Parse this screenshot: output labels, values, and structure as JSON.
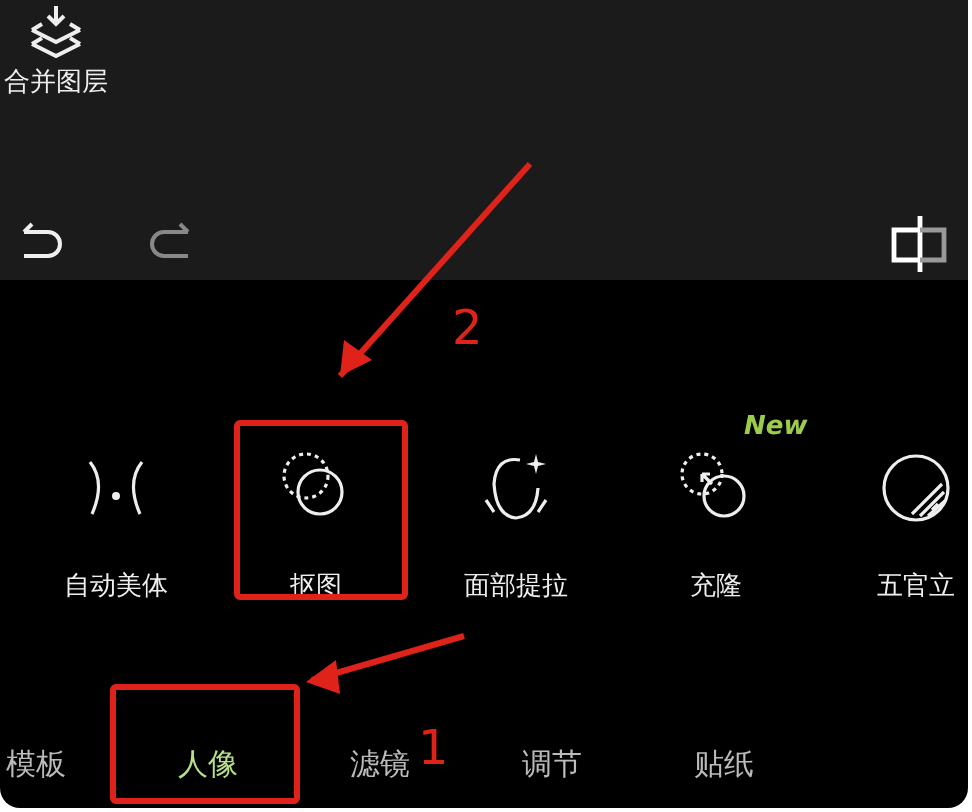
{
  "top_bar": {
    "merge_layers": "合并图层"
  },
  "tools": [
    {
      "label": "自动美体"
    },
    {
      "label": "抠图"
    },
    {
      "label": "面部提拉"
    },
    {
      "label": "充隆",
      "badge": "New"
    },
    {
      "label": "五官立"
    }
  ],
  "tabs": [
    {
      "label": "模板",
      "selected": false
    },
    {
      "label": "人像",
      "selected": true
    },
    {
      "label": "滤镜",
      "selected": false
    },
    {
      "label": "调节",
      "selected": false
    },
    {
      "label": "贴纸",
      "selected": false
    }
  ],
  "callouts": [
    {
      "number": "2"
    },
    {
      "number": "1"
    }
  ]
}
